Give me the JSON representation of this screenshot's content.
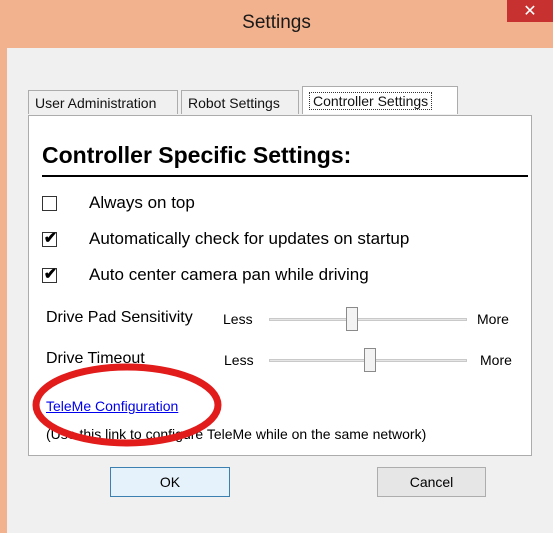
{
  "window": {
    "title": "Settings",
    "close_glyph": "✕"
  },
  "tabs": [
    {
      "label": "User Administration"
    },
    {
      "label": "Robot Settings"
    },
    {
      "label": "Controller Settings"
    }
  ],
  "section": {
    "heading": "Controller Specific Settings:"
  },
  "checkboxes": [
    {
      "label": "Always on top",
      "checked": false
    },
    {
      "label": "Automatically check for updates on startup",
      "checked": true
    },
    {
      "label": "Auto center camera pan while driving",
      "checked": true
    }
  ],
  "check_mark": "✔",
  "sliders": [
    {
      "label": "Drive Pad Sensitivity",
      "min_label": "Less",
      "max_label": "More",
      "level": 0.42
    },
    {
      "label": "Drive Timeout",
      "min_label": "Less",
      "max_label": "More",
      "level": 0.51
    }
  ],
  "link": {
    "text": "TeleMe Configuration"
  },
  "hint": "(Use this link to configure TeleMe while on the same network)",
  "buttons": {
    "ok": "OK",
    "cancel": "Cancel"
  },
  "annotation": {
    "ellipse_color": "#e21b1b"
  }
}
